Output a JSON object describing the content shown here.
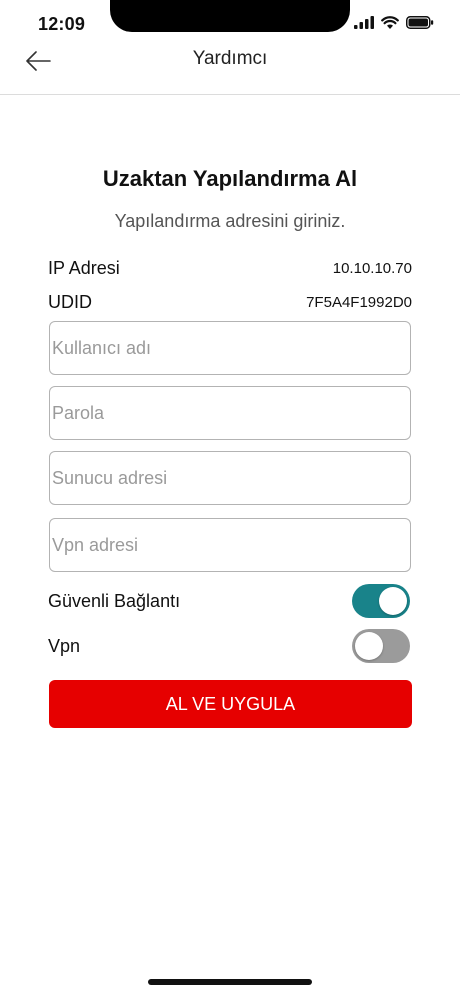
{
  "status_bar": {
    "time": "12:09"
  },
  "header": {
    "title": "Yardımcı"
  },
  "page": {
    "title": "Uzaktan Yapılandırma Al",
    "subtitle": "Yapılandırma adresini giriniz."
  },
  "info": {
    "ip_label": "IP Adresi",
    "ip_value": "10.10.10.70",
    "udid_label": "UDID",
    "udid_value": "7F5A4F1992D0"
  },
  "form": {
    "username_placeholder": "Kullanıcı adı",
    "username_value": "",
    "password_placeholder": "Parola",
    "password_value": "",
    "server_placeholder": "Sunucu adresi",
    "server_value": "",
    "vpn_address_placeholder": "Vpn adresi",
    "vpn_address_value": ""
  },
  "toggles": {
    "secure_label": "Güvenli Bağlantı",
    "secure_on": true,
    "vpn_label": "Vpn",
    "vpn_on": false
  },
  "buttons": {
    "submit_label": "AL VE UYGULA"
  },
  "colors": {
    "accent_red": "#e60000",
    "toggle_on": "#19838a",
    "toggle_off": "#9b9b9b"
  },
  "icons": {
    "back": "arrow-left-icon",
    "signal": "cellular-signal-icon",
    "wifi": "wifi-icon",
    "battery": "battery-icon"
  }
}
